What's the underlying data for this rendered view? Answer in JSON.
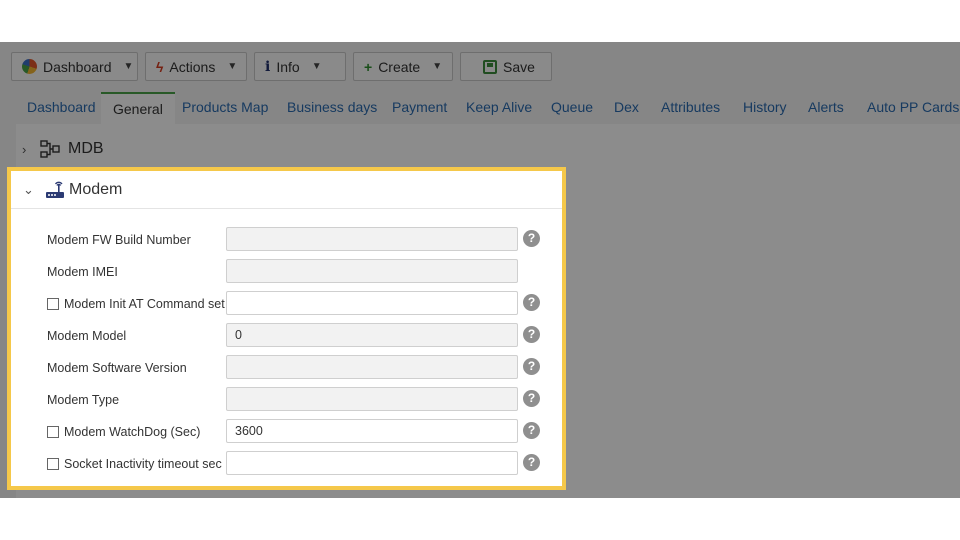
{
  "toolbar": {
    "dashboard": "Dashboard",
    "actions": "Actions",
    "info": "Info",
    "create": "Create",
    "save": "Save"
  },
  "tabs": [
    {
      "label": "Dashboard"
    },
    {
      "label": "General",
      "active": true
    },
    {
      "label": "Products Map"
    },
    {
      "label": "Business days"
    },
    {
      "label": "Payment"
    },
    {
      "label": "Keep Alive"
    },
    {
      "label": "Queue"
    },
    {
      "label": "Dex"
    },
    {
      "label": "Attributes"
    },
    {
      "label": "History"
    },
    {
      "label": "Alerts"
    },
    {
      "label": "Auto PP Cards"
    }
  ],
  "sections": {
    "mdb": {
      "title": "MDB",
      "icon": "diagram-icon",
      "expanded": false
    },
    "modem": {
      "title": "Modem",
      "icon": "router-icon",
      "expanded": true
    }
  },
  "modem_fields": [
    {
      "label": "Modem FW Build Number",
      "value": "",
      "checkbox": false,
      "readonly": true,
      "help": true
    },
    {
      "label": "Modem IMEI",
      "value": "",
      "checkbox": false,
      "readonly": true,
      "help": false
    },
    {
      "label": "Modem Init AT Command set",
      "value": "",
      "checkbox": true,
      "readonly": false,
      "help": true
    },
    {
      "label": "Modem Model",
      "value": "0",
      "checkbox": false,
      "readonly": true,
      "help": true
    },
    {
      "label": "Modem Software Version",
      "value": "",
      "checkbox": false,
      "readonly": true,
      "help": true
    },
    {
      "label": "Modem Type",
      "value": "",
      "checkbox": false,
      "readonly": true,
      "help": true
    },
    {
      "label": "Modem WatchDog (Sec)",
      "value": "3600",
      "checkbox": true,
      "readonly": false,
      "help": true
    },
    {
      "label": "Socket Inactivity timeout sec",
      "value": "",
      "checkbox": true,
      "readonly": false,
      "help": true
    }
  ],
  "help_glyph": "?",
  "colors": {
    "highlight": "#f5c84a",
    "tab_link": "#2a6bb0",
    "active_tab_accent": "#4aa347"
  }
}
